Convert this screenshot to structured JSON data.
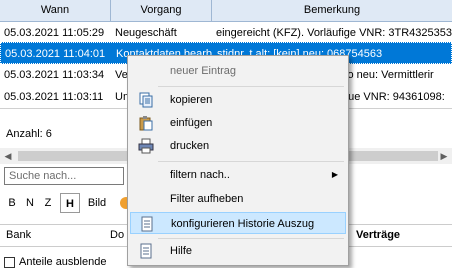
{
  "grid": {
    "columns": [
      "Wann",
      "Vorgang",
      "Bemerkung"
    ],
    "rows": [
      {
        "wann": "05.03.2021 11:05:29",
        "vorgang": "Neugeschäft",
        "bemerkung": "eingereicht (KFZ). Vorläufige VNR: 3TR4325353"
      },
      {
        "wann": "05.03.2021 11:04:01",
        "vorgang": "Kontaktdaten bearb",
        "bemerkung": "stidnr. t alt: [kein] neu: 068754563",
        "selected": true
      },
      {
        "wann": "05.03.2021 11:03:34",
        "vorgang": "Ve",
        "bemerkung": "so neu: Vermittlerir"
      },
      {
        "wann": "05.03.2021 11:03:11",
        "vorgang": "Um",
        "bemerkung": "eue VNR: 94361098:"
      }
    ]
  },
  "status": {
    "count_label": "Anzahl: 6"
  },
  "search": {
    "placeholder": "Suche nach..."
  },
  "format_buttons": [
    "B",
    "N",
    "Z",
    "H",
    "Bild"
  ],
  "bottom_header": {
    "bank": "Bank",
    "do": "Do",
    "vertraege": "Verträge"
  },
  "checkbox": {
    "label": "Anteile ausblende"
  },
  "context_menu": {
    "items": [
      {
        "label": "neuer Eintrag",
        "disabled": true,
        "icon": ""
      },
      {
        "label": "kopieren",
        "icon": "copy-icon"
      },
      {
        "label": "einfügen",
        "icon": "paste-icon"
      },
      {
        "label": "drucken",
        "icon": "print-icon"
      },
      {
        "label": "filtern nach..",
        "icon": "",
        "submenu": true
      },
      {
        "label": "Filter aufheben",
        "icon": ""
      },
      {
        "label": "konfigurieren Historie Auszug",
        "icon": "document-icon",
        "highlighted": true
      },
      {
        "label": "Hilfe",
        "icon": "help-icon"
      }
    ]
  },
  "colors": {
    "selection": "#0078d7",
    "menu_highlight": "#cce8ff",
    "header": "#dfe9f5"
  }
}
